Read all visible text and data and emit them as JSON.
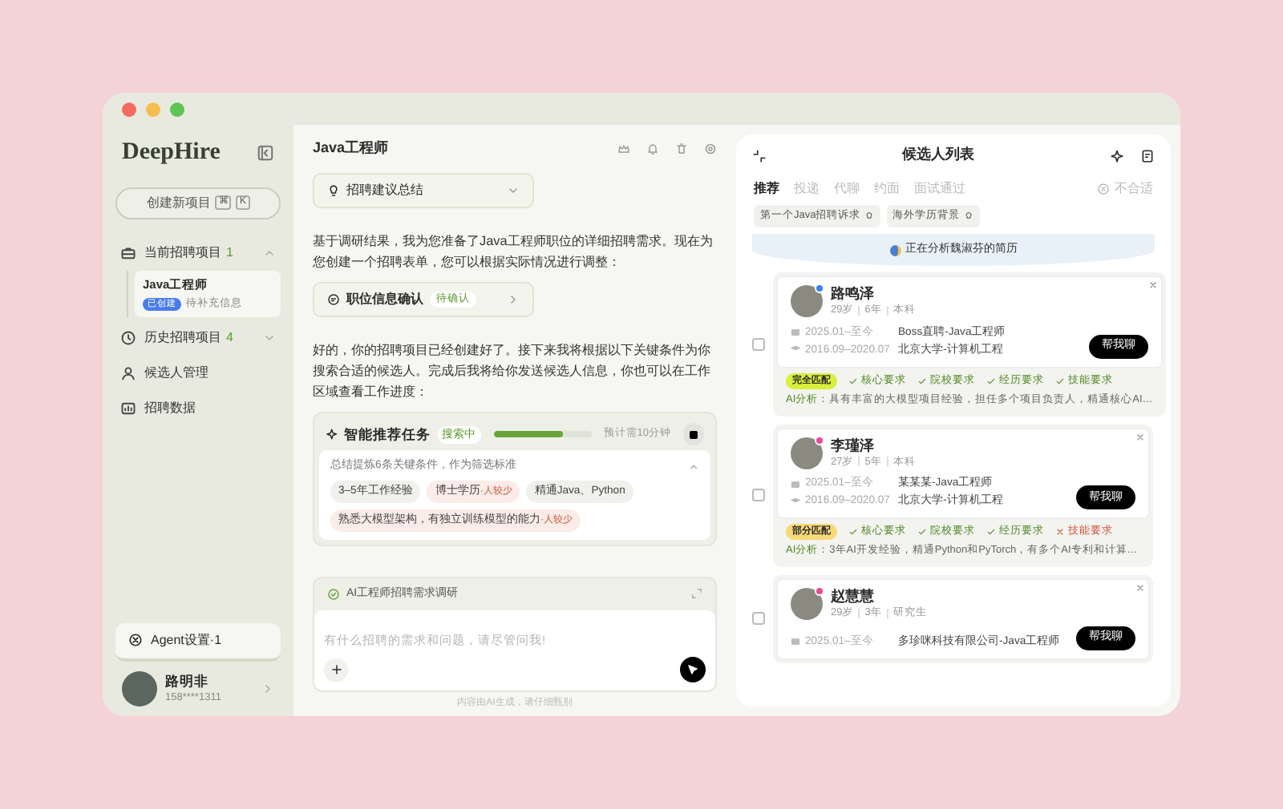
{
  "window": {
    "brand": "DeepHire"
  },
  "sidebar": {
    "new_project": {
      "label": "创建新项目",
      "keys": [
        "⌘",
        "K"
      ]
    },
    "items": [
      {
        "kind": "group",
        "label": "当前招聘项目",
        "count": "1",
        "expanded": true,
        "children": [
          {
            "title": "Java工程师",
            "badge": "已创建",
            "status": "待补充信息",
            "selected": true
          }
        ]
      },
      {
        "kind": "group",
        "label": "历史招聘项目",
        "count": "4",
        "expanded": false
      },
      {
        "kind": "link",
        "label": "候选人管理"
      },
      {
        "kind": "link",
        "label": "招聘数据"
      }
    ],
    "agent": "Agent设置·1",
    "user": {
      "name": "路明非",
      "phone": "158****1311"
    }
  },
  "chat": {
    "title": "Java工程师",
    "summary_dropdown": "招聘建议总结",
    "messages": [
      {
        "kind": "text",
        "text": "基于调研结果，我为您准备了Java工程师职位的详细招聘需求。现在为您创建一个招聘表单，您可以根据实际情况进行调整："
      },
      {
        "kind": "card",
        "title": "职位信息确认",
        "badge": "待确认"
      },
      {
        "kind": "text",
        "text": "好的，你的招聘项目已经创建好了。接下来我将根据以下关键条件为你搜索合适的候选人。完成后我将给你发送候选人信息，你也可以在工作区域查看工作进度："
      }
    ],
    "task": {
      "title": "智能推荐任务",
      "status": "搜索中",
      "level": 0.7,
      "eta": "预计需10分钟",
      "summary": "总结提炼6条关键条件，作为筛选标准",
      "expanded": true,
      "conditions": [
        {
          "text": "3–5年工作经验"
        },
        {
          "text": "博士学历",
          "note": "·人较少"
        },
        {
          "text": "精通Java、Python"
        },
        {
          "text": "熟悉大模型架构，有独立训练模型的能力",
          "note": "·人较少"
        }
      ]
    },
    "composer": {
      "context": "AI工程师招聘需求调研",
      "placeholder": "有什么招聘的需求和问题，请尽管问我!"
    },
    "disclaimer": "内容由AI生成，请仔细甄别"
  },
  "candidates": {
    "title": "候选人列表",
    "tabs": [
      {
        "label": "推荐",
        "selected": true
      },
      {
        "label": "投递",
        "selected": false
      },
      {
        "label": "代聊",
        "selected": false
      },
      {
        "label": "约面",
        "selected": false
      },
      {
        "label": "面试通过",
        "selected": false
      }
    ],
    "reject": "不合适",
    "filters": [
      "第一个Java招聘诉求",
      "海外学历背景"
    ],
    "banner": "正在分析魏淑芬的简历",
    "list": [
      {
        "name": "路鸣泽",
        "color": "#3b82f6",
        "age": "29岁",
        "years": "6年",
        "degree": "本科",
        "job_period": "2025.01–至今",
        "job": "Boss直聘-Java工程师",
        "edu_period": "2016.09–2020.07",
        "edu": "北京大学-计算机工程",
        "action": "帮我聊",
        "checked": false,
        "match": {
          "kind": "full",
          "label": "完全匹配"
        },
        "criteria": [
          {
            "label": "核心要求",
            "met": true
          },
          {
            "label": "院校要求",
            "met": true
          },
          {
            "label": "经历要求",
            "met": true
          },
          {
            "label": "技能要求",
            "met": true
          }
        ],
        "analysis_label": "AI分析：",
        "analysis": "具有丰富的大模型项目经验，担任多个项目负责人，精通核心AI…"
      },
      {
        "name": "李瑾泽",
        "color": "#ec4899",
        "age": "27岁",
        "years": "5年",
        "degree": "本科",
        "job_period": "2025.01–至今",
        "job": "某某某-Java工程师",
        "edu_period": "2016.09–2020.07",
        "edu": "北京大学-计算机工程",
        "action": "帮我聊",
        "checked": false,
        "match": {
          "kind": "partial",
          "label": "部分匹配"
        },
        "criteria": [
          {
            "label": "核心要求",
            "met": true
          },
          {
            "label": "院校要求",
            "met": true
          },
          {
            "label": "经历要求",
            "met": true
          },
          {
            "label": "技能要求",
            "met": false
          }
        ],
        "analysis_label": "AI分析：",
        "analysis": "3年AI开发经验，精通Python和PyTorch，有多个AI专利和计算…"
      },
      {
        "name": "赵慧慧",
        "color": "#ec4899",
        "age": "29岁",
        "years": "3年",
        "degree": "研究生",
        "job_period": "2025.01–至今",
        "job": "多珍咪科技有限公司-Java工程师",
        "action": "帮我聊",
        "checked": false
      }
    ]
  }
}
